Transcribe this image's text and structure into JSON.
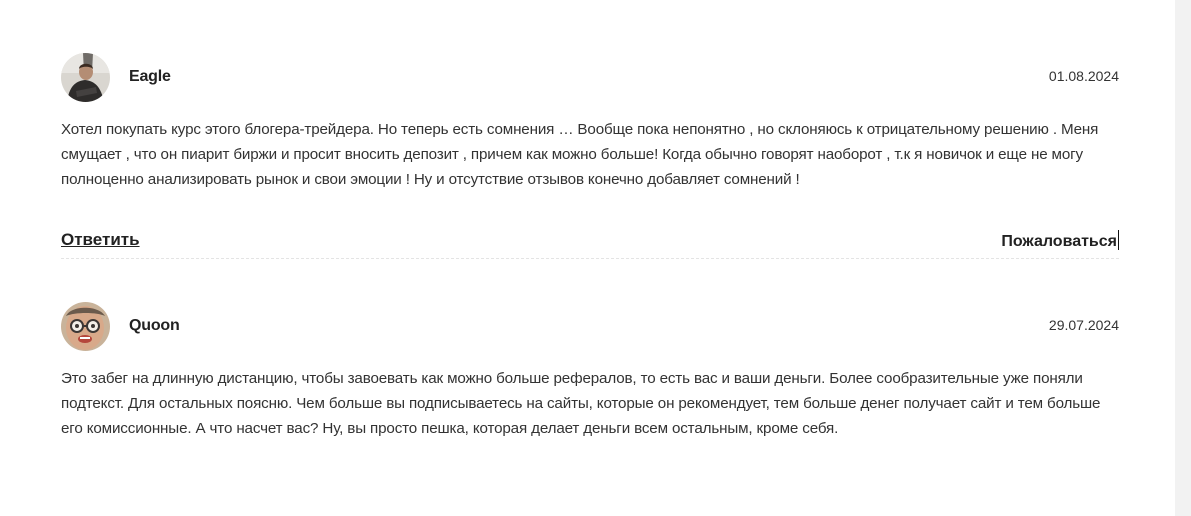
{
  "comments": [
    {
      "author": "Eagle",
      "date": "01.08.2024",
      "avatar_icon": "user-photo-avatar",
      "text": "Хотел покупать курс этого блогера-трейдера. Но теперь есть сомнения … Вообще пока непонятно , но склоняюсь к отрицательному решению . Меня смущает , что он пиарит биржи и просит вносить депозит , причем как можно больше! Когда обычно говорят наоборот , т.к я новичок и еще не могу полноценно анализировать рынок и свои эмоции ! Ну и отсутствие отзывов конечно добавляет сомнений !",
      "reply_label": "Ответить",
      "report_label": "Пожаловаться"
    },
    {
      "author": "Quoon",
      "date": "29.07.2024",
      "avatar_icon": "user-photo-avatar",
      "text": "Это забег на длинную дистанцию, чтобы завоевать как можно больше рефералов, то есть вас и ваши деньги. Более сообразительные уже поняли подтекст. Для остальных поясню. Чем больше вы подписываетесь на сайты, которые он рекомендует, тем больше денег получает сайт и тем больше его комиссионные. А что насчет вас? Ну, вы просто пешка, которая делает деньги всем остальным, кроме себя."
    }
  ],
  "colors": {
    "text": "#333333",
    "heading": "#222222",
    "divider": "#e4e4e4",
    "scroll_track": "#f2f2f2"
  }
}
